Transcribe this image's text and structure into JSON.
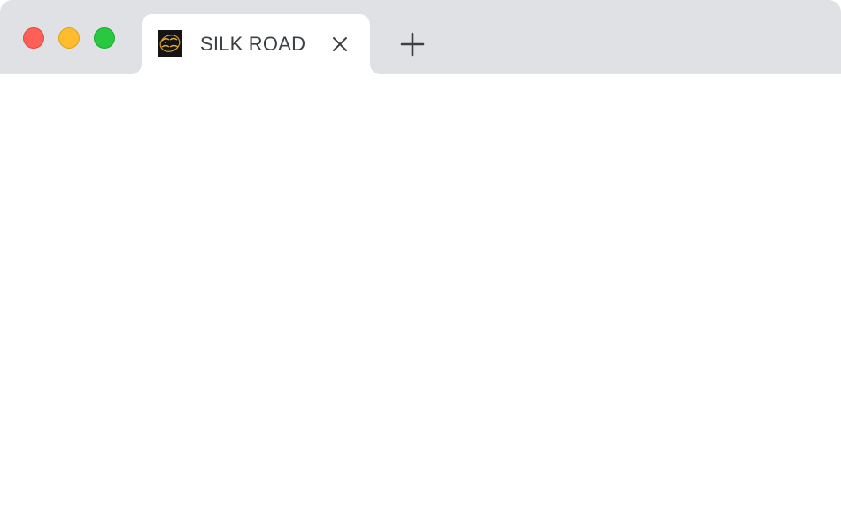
{
  "window": {
    "controls": {
      "close_color": "#ff5f57",
      "minimize_color": "#febc2e",
      "zoom_color": "#28c840"
    }
  },
  "tabs": [
    {
      "title": "SILK ROAD",
      "favicon": "silk-road-logo-icon",
      "active": true
    }
  ],
  "icons": {
    "tab_close": "close-icon",
    "new_tab": "plus-icon"
  },
  "colors": {
    "tabbar_background": "#dfe1e5",
    "active_tab_background": "#ffffff",
    "tab_text": "#3c4043"
  }
}
